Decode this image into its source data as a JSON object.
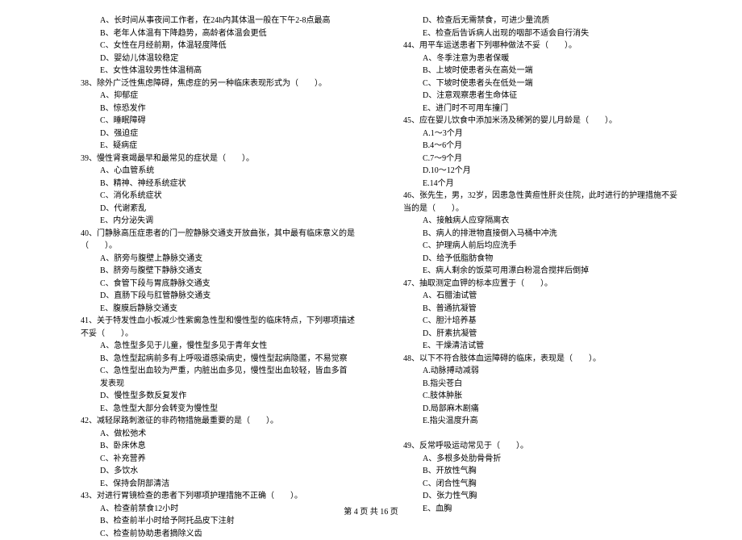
{
  "left_col": [
    {
      "t": "option",
      "text": "A、长时间从事夜间工作者，在24h内其体温一般在下午2-8点最高"
    },
    {
      "t": "option",
      "text": "B、老年人体温有下降趋势，高龄者体温会更低"
    },
    {
      "t": "option",
      "text": "C、女性在月经前期，体温轻度降低"
    },
    {
      "t": "option",
      "text": "D、婴幼儿体温较稳定"
    },
    {
      "t": "option",
      "text": "E、女性体温较男性体温稍高"
    },
    {
      "t": "question",
      "text": "38、除外广泛性焦虑障碍，焦虑症的另一种临床表现形式为（　　）。"
    },
    {
      "t": "option",
      "text": "A、抑郁症"
    },
    {
      "t": "option",
      "text": "B、惊恐发作"
    },
    {
      "t": "option",
      "text": "C、睡眠障碍"
    },
    {
      "t": "option",
      "text": "D、强迫症"
    },
    {
      "t": "option",
      "text": "E、疑病症"
    },
    {
      "t": "question",
      "text": "39、慢性肾衰竭最早和最常见的症状是（　　）。"
    },
    {
      "t": "option",
      "text": "A、心血管系统"
    },
    {
      "t": "option",
      "text": "B、精神、神经系统症状"
    },
    {
      "t": "option",
      "text": "C、消化系统症状"
    },
    {
      "t": "option",
      "text": "D、代谢紊乱"
    },
    {
      "t": "option",
      "text": "E、内分泌失调"
    },
    {
      "t": "question",
      "text": "40、门静脉高压症患者的门一腔静脉交通支开放曲张，其中最有临床意义的是（　　）。"
    },
    {
      "t": "option",
      "text": "A、脐旁与腹壁上静脉交通支"
    },
    {
      "t": "option",
      "text": "B、脐旁与腹壁下静脉交通支"
    },
    {
      "t": "option",
      "text": "C、食管下段与胃底静脉交通支"
    },
    {
      "t": "option",
      "text": "D、直肠下段与肛管静脉交通支"
    },
    {
      "t": "option",
      "text": "E、腹膜后静脉交通支"
    },
    {
      "t": "question",
      "text": "41、关于特发性血小板减少性紫癜急性型和慢性型的临床特点，下列哪项描述不妥（　　）。"
    },
    {
      "t": "option",
      "text": "A、急性型多见于儿童，慢性型多见于青年女性"
    },
    {
      "t": "option",
      "text": "B、急性型起病前多有上呼吸道感染病史，慢性型起病隐匿，不易觉察"
    },
    {
      "t": "option",
      "text": "C、急性型出血较为严重，内脏出血多见，慢性型出血较轻，皆血多首发表现"
    },
    {
      "t": "option",
      "text": "D、慢性型多数反复发作"
    },
    {
      "t": "option",
      "text": "E、急性型大部分会转变为慢性型"
    },
    {
      "t": "question",
      "text": "42、减轻尿路刺激征的非药物措施最重要的是（　　）。"
    },
    {
      "t": "option",
      "text": "A、做松弛术"
    },
    {
      "t": "option",
      "text": "B、卧床休息"
    },
    {
      "t": "option",
      "text": "C、补充营养"
    },
    {
      "t": "option",
      "text": "D、多饮水"
    },
    {
      "t": "option",
      "text": "E、保持会阴部清洁"
    },
    {
      "t": "question",
      "text": "43、对进行胃镜检查的患者下列哪项护理措施不正确（　　）。"
    },
    {
      "t": "option",
      "text": "A、检查前禁食12小时"
    },
    {
      "t": "option",
      "text": "B、检查前半小时给予阿托品皮下注射"
    },
    {
      "t": "option",
      "text": "C、检查前协助患者摘除义齿"
    }
  ],
  "right_col": [
    {
      "t": "option",
      "text": "D、检查后无需禁食，可进少量流质"
    },
    {
      "t": "option",
      "text": "E、检查后告诉病人出现的咽部不适会自行消失"
    },
    {
      "t": "question",
      "text": "44、用平车运送患者下列哪种做法不妥（　　）。"
    },
    {
      "t": "option",
      "text": "A、冬季注意为患者保暖"
    },
    {
      "t": "option",
      "text": "B、上坡时使患者头在高处一端"
    },
    {
      "t": "option",
      "text": "C、下坡时使患者头在低处一端"
    },
    {
      "t": "option",
      "text": "D、注意观察患者生命体征"
    },
    {
      "t": "option",
      "text": "E、进门时不可用车撞门"
    },
    {
      "t": "question",
      "text": "45、应在婴儿饮食中添加米汤及稀粥的婴儿月龄是（　　）。"
    },
    {
      "t": "option",
      "text": "A.1～3个月"
    },
    {
      "t": "option",
      "text": "B.4～6个月"
    },
    {
      "t": "option",
      "text": "C.7～9个月"
    },
    {
      "t": "option",
      "text": "D.10～12个月"
    },
    {
      "t": "option",
      "text": "E.14个月"
    },
    {
      "t": "question",
      "text": "46、张先生，男，32岁，因患急性黄疸性肝炎住院，此时进行的护理措施不妥当的是（　　）。"
    },
    {
      "t": "option",
      "text": "A、接触病人应穿隔离衣"
    },
    {
      "t": "option",
      "text": "B、病人的排泄物直接倒入马桶中冲洗"
    },
    {
      "t": "option",
      "text": "C、护理病人前后均应洗手"
    },
    {
      "t": "option",
      "text": "D、给予低脂肪食物"
    },
    {
      "t": "option",
      "text": "E、病人剩余的饭菜可用漂白粉混合搅拌后倒掉"
    },
    {
      "t": "question",
      "text": "47、抽取测定血钾的标本应置于（　　）。"
    },
    {
      "t": "option",
      "text": "A、石腊油试管"
    },
    {
      "t": "option",
      "text": "B、普通抗凝管"
    },
    {
      "t": "option",
      "text": "C、胆汁培养基"
    },
    {
      "t": "option",
      "text": "D、肝素抗凝管"
    },
    {
      "t": "option",
      "text": "E、干燥清洁试管"
    },
    {
      "t": "question",
      "text": "48、以下不符合肢体血运障碍的临床，表现是（　　）。"
    },
    {
      "t": "option",
      "text": "A.动脉搏动减弱"
    },
    {
      "t": "option",
      "text": "B.指尖苍白"
    },
    {
      "t": "option",
      "text": "C.肢体肿胀"
    },
    {
      "t": "option",
      "text": "D.局部麻木剧痛"
    },
    {
      "t": "option",
      "text": "E.指尖温度升高"
    },
    {
      "t": "blank",
      "text": ""
    },
    {
      "t": "question",
      "text": "49、反常呼吸运动常见于（　　）。"
    },
    {
      "t": "option",
      "text": "A、多根多处肋骨骨折"
    },
    {
      "t": "option",
      "text": "B、开放性气胸"
    },
    {
      "t": "option",
      "text": "C、闭合性气胸"
    },
    {
      "t": "option",
      "text": "D、张力性气胸"
    },
    {
      "t": "option",
      "text": "E、血胸"
    }
  ],
  "footer": "第 4 页 共 16 页"
}
